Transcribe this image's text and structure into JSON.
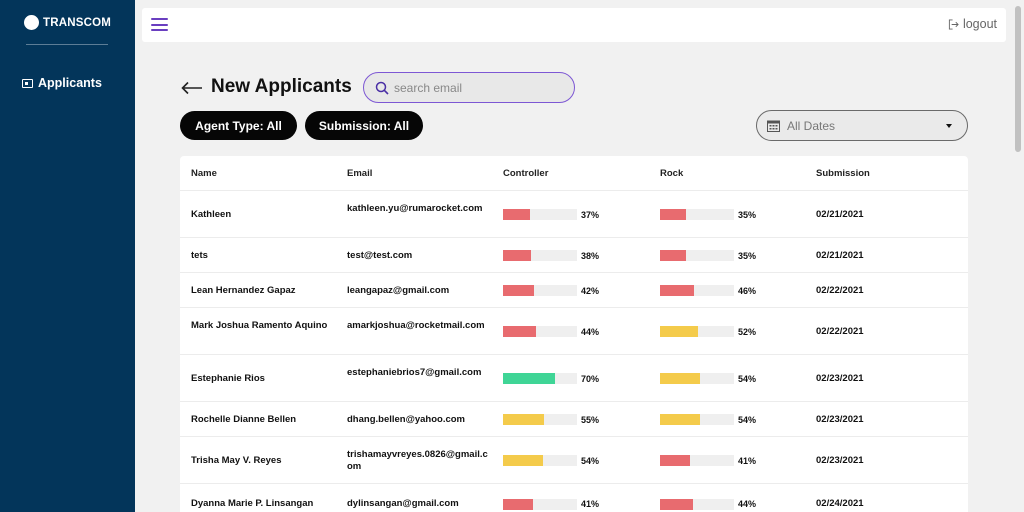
{
  "brand": {
    "name": "TRANSCOM"
  },
  "sidebar": {
    "items": [
      {
        "label": "Applicants",
        "icon": "id-card-icon"
      }
    ]
  },
  "topbar": {
    "menu_icon": "hamburger-icon",
    "logout_label": "logout",
    "logout_icon": "logout-icon"
  },
  "page": {
    "title": "New Applicants",
    "back_icon": "arrow-left-icon"
  },
  "search": {
    "placeholder": "search email",
    "value": ""
  },
  "filters": {
    "agent_type": "Agent Type: All",
    "submission": "Submission: All"
  },
  "date_filter": {
    "selected": "All Dates",
    "icon": "calendar-icon"
  },
  "colors": {
    "sidebar": "#03355a",
    "accent": "#6a3fc0",
    "red": "#e86b6f",
    "yellow": "#f4cb4b",
    "green": "#3fd596"
  },
  "table": {
    "columns": [
      "Name",
      "Email",
      "Controller",
      "Rock",
      "Submission"
    ],
    "rows": [
      {
        "name": "Kathleen",
        "email": "kathleen.yu@rumarocket.com",
        "controller": "37%",
        "rock": "35%",
        "submission": "02/21/2021"
      },
      {
        "name": "tets",
        "email": "test@test.com",
        "controller": "38%",
        "rock": "35%",
        "submission": "02/21/2021"
      },
      {
        "name": "Lean Hernandez Gapaz",
        "email": "leangapaz@gmail.com",
        "controller": "42%",
        "rock": "46%",
        "submission": "02/22/2021"
      },
      {
        "name": "Mark Joshua Ramento Aquino",
        "email": "amarkjoshua@rocketmail.com",
        "controller": "44%",
        "rock": "52%",
        "submission": "02/22/2021"
      },
      {
        "name": "Estephanie Rios",
        "email": "estephaniebrios7@gmail.com",
        "controller": "70%",
        "rock": "54%",
        "submission": "02/23/2021"
      },
      {
        "name": "Rochelle Dianne Bellen",
        "email": "dhang.bellen@yahoo.com",
        "controller": "55%",
        "rock": "54%",
        "submission": "02/23/2021"
      },
      {
        "name": "Trisha May V. Reyes",
        "email": "trishamayvreyes.0826@gmail.com",
        "controller": "54%",
        "rock": "41%",
        "submission": "02/23/2021"
      },
      {
        "name": "Dyanna Marie P. Linsangan",
        "email": "dylinsangan@gmail.com",
        "controller": "41%",
        "rock": "44%",
        "submission": "02/24/2021"
      }
    ]
  }
}
